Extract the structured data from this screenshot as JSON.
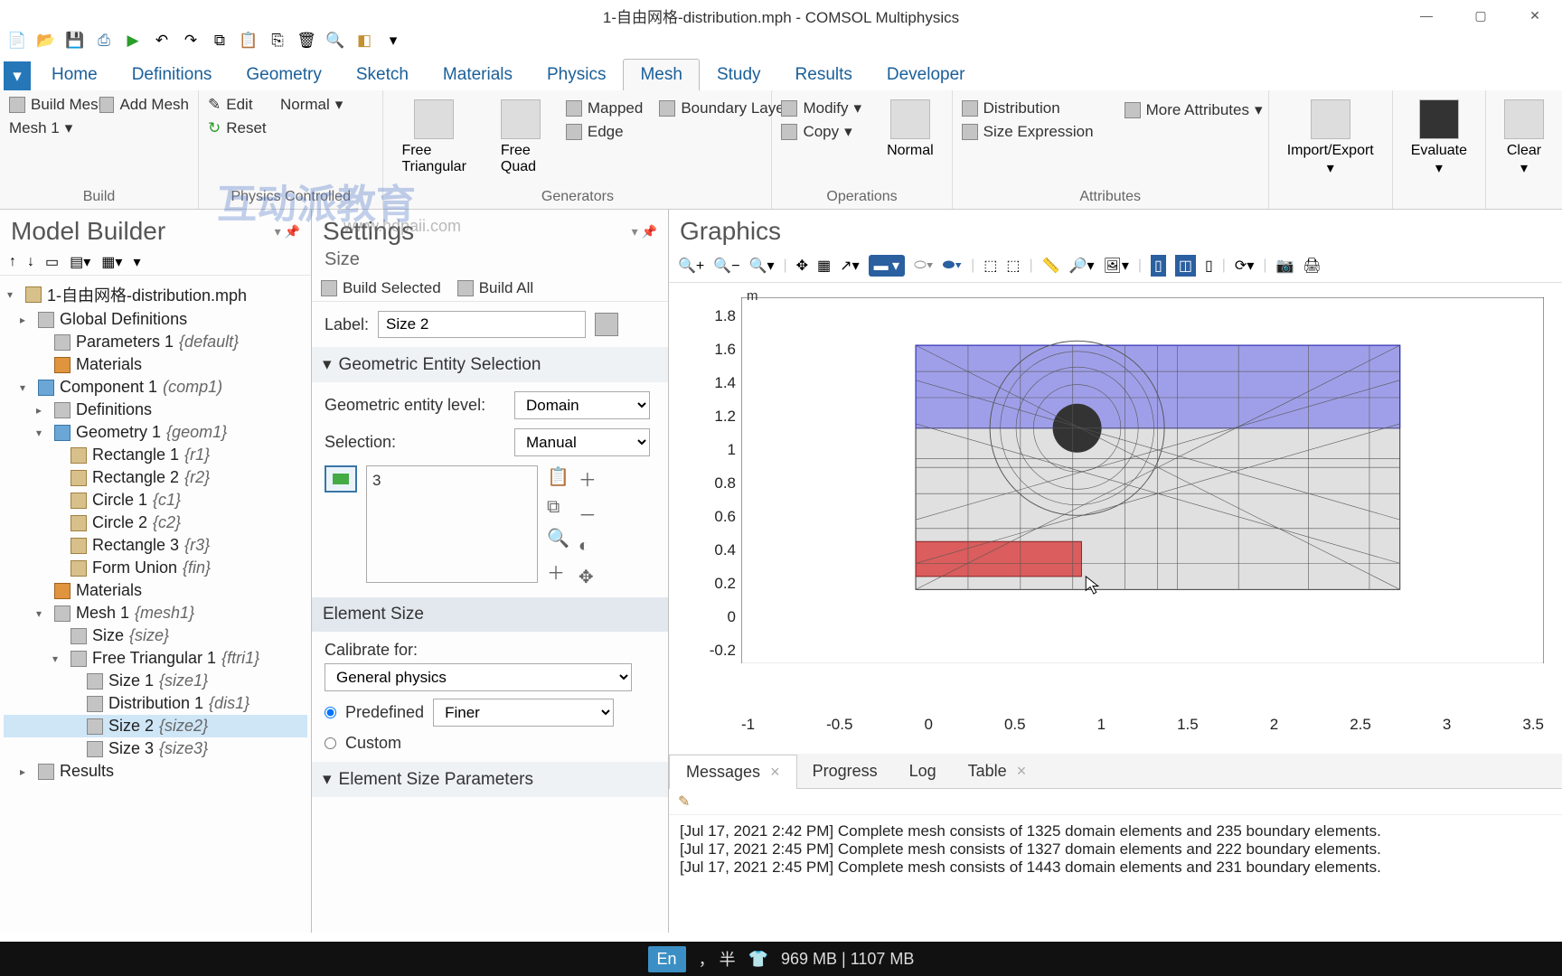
{
  "title": "1-自由网格-distribution.mph - COMSOL Multiphysics",
  "tabs": [
    "Home",
    "Definitions",
    "Geometry",
    "Sketch",
    "Materials",
    "Physics",
    "Mesh",
    "Study",
    "Results",
    "Developer"
  ],
  "active_tab": "Mesh",
  "ribbon": {
    "build": {
      "build_mesh": "Build Mesh",
      "add_mesh": "Add Mesh",
      "mesh_select": "Mesh 1",
      "label": "Build"
    },
    "pc": {
      "edit": "Edit",
      "normal": "Normal",
      "reset": "Reset",
      "label": "Physics Controlled"
    },
    "gen": {
      "ftri": "Free Triangular",
      "fquad": "Free Quad",
      "mapped": "Mapped",
      "boundary": "Boundary Layers",
      "edge": "Edge",
      "label": "Generators"
    },
    "ops": {
      "modify": "Modify",
      "copy": "Copy",
      "normal": "Normal",
      "label": "Operations"
    },
    "attr": {
      "dist": "Distribution",
      "sizeexpr": "Size Expression",
      "more": "More Attributes",
      "label": "Attributes"
    },
    "ie": "Import/Export",
    "eval": "Evaluate",
    "clear": "Clear"
  },
  "model_builder": {
    "title": "Model Builder",
    "root": "1-自由网格-distribution.mph",
    "items": [
      {
        "label": "Global Definitions",
        "ind": 1,
        "exp": "▸",
        "ico": "globe"
      },
      {
        "label": "Parameters 1",
        "italic": "{default}",
        "ind": 2,
        "ico": "param"
      },
      {
        "label": "Materials",
        "ind": 2,
        "ico": "mat"
      },
      {
        "label": "Component 1",
        "italic": "(comp1)",
        "ind": 1,
        "exp": "▾",
        "ico": "comp"
      },
      {
        "label": "Definitions",
        "ind": 2,
        "exp": "▸",
        "ico": "def"
      },
      {
        "label": "Geometry 1",
        "italic": "{geom1}",
        "ind": 2,
        "exp": "▾",
        "ico": "geom"
      },
      {
        "label": "Rectangle 1",
        "italic": "{r1}",
        "ind": 3,
        "ico": "rect"
      },
      {
        "label": "Rectangle 2",
        "italic": "{r2}",
        "ind": 3,
        "ico": "rect"
      },
      {
        "label": "Circle 1",
        "italic": "{c1}",
        "ind": 3,
        "ico": "circ"
      },
      {
        "label": "Circle 2",
        "italic": "{c2}",
        "ind": 3,
        "ico": "circ"
      },
      {
        "label": "Rectangle 3",
        "italic": "{r3}",
        "ind": 3,
        "ico": "rect"
      },
      {
        "label": "Form Union",
        "italic": "{fin}",
        "ind": 3,
        "ico": "union"
      },
      {
        "label": "Materials",
        "ind": 2,
        "ico": "mat"
      },
      {
        "label": "Mesh 1",
        "italic": "{mesh1}",
        "ind": 2,
        "exp": "▾",
        "ico": "mesh"
      },
      {
        "label": "Size",
        "italic": "{size}",
        "ind": 3,
        "ico": "size"
      },
      {
        "label": "Free Triangular 1",
        "italic": "{ftri1}",
        "ind": 3,
        "exp": "▾",
        "ico": "ftri"
      },
      {
        "label": "Size 1",
        "italic": "{size1}",
        "ind": 4,
        "ico": "size"
      },
      {
        "label": "Distribution 1",
        "italic": "{dis1}",
        "ind": 4,
        "ico": "dist"
      },
      {
        "label": "Size 2",
        "italic": "{size2}",
        "ind": 4,
        "ico": "size",
        "sel": true
      },
      {
        "label": "Size 3",
        "italic": "{size3}",
        "ind": 4,
        "ico": "size"
      },
      {
        "label": "Results",
        "ind": 1,
        "exp": "▸",
        "ico": "res"
      }
    ]
  },
  "settings": {
    "title": "Settings",
    "subtitle": "Size",
    "build_sel": "Build Selected",
    "build_all": "Build All",
    "label_lbl": "Label:",
    "label_val": "Size 2",
    "geo_sel": "Geometric Entity Selection",
    "level_lbl": "Geometric entity level:",
    "level_val": "Domain",
    "selection_lbl": "Selection:",
    "selection_val": "Manual",
    "sel_items": "3",
    "elsize": "Element Size",
    "calibrate_lbl": "Calibrate for:",
    "calibrate_val": "General physics",
    "predef": "Predefined",
    "predef_val": "Finer",
    "custom": "Custom",
    "elparams": "Element Size Parameters"
  },
  "graphics": {
    "title": "Graphics",
    "unit": "m",
    "yticks": [
      "1.8",
      "1.6",
      "1.4",
      "1.2",
      "1",
      "0.8",
      "0.6",
      "0.4",
      "0.2",
      "0",
      "-0.2"
    ],
    "xticks": [
      "-1",
      "-0.5",
      "0",
      "0.5",
      "1",
      "1.5",
      "2",
      "2.5",
      "3",
      "3.5"
    ]
  },
  "messages": {
    "tabs": [
      "Messages",
      "Progress",
      "Log",
      "Table"
    ],
    "lines": [
      "[Jul 17, 2021 2:42 PM] Complete mesh consists of 1325 domain elements and 235 boundary elements.",
      "[Jul 17, 2021 2:45 PM] Complete mesh consists of 1327 domain elements and 222 boundary elements.",
      "[Jul 17, 2021 2:45 PM] Complete mesh consists of 1443 domain elements and 231 boundary elements."
    ]
  },
  "status": {
    "ime": "En",
    "extra": "， 半",
    "mem": "969 MB | 1107 MB"
  },
  "watermark": "互动派教育",
  "watermark_url": "www.hdpaii.com"
}
